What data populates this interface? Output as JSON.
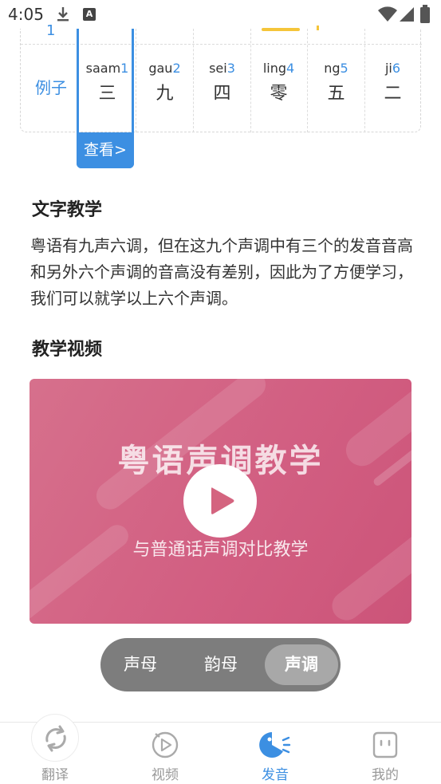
{
  "status_bar": {
    "time": "4:05"
  },
  "tone_table": {
    "top_stub": "1",
    "row_label": "例子",
    "cells": [
      {
        "roman": "saam",
        "tone": "1",
        "hanzi": "三"
      },
      {
        "roman": "gau",
        "tone": "2",
        "hanzi": "九"
      },
      {
        "roman": "sei",
        "tone": "3",
        "hanzi": "四"
      },
      {
        "roman": "ling",
        "tone": "4",
        "hanzi": "零"
      },
      {
        "roman": "ng",
        "tone": "5",
        "hanzi": "五"
      },
      {
        "roman": "ji",
        "tone": "6",
        "hanzi": "二"
      }
    ],
    "view_label": "查看>"
  },
  "text_section": {
    "title": "文字教学",
    "body": "粤语有九声六调，但在这九个声调中有三个的发音音高和另外六个声调的音高没有差别，因此为了方便学习，我们可以就学以上六个声调。"
  },
  "video_section": {
    "title": "教学视频",
    "video_title": "粤语声调教学",
    "video_subtitle": "与普通话声调对比教学"
  },
  "segments": {
    "items": [
      "声母",
      "韵母",
      "声调"
    ],
    "selected": "声调"
  },
  "bottom_nav": {
    "items": [
      {
        "label": "翻译",
        "icon": "sync-icon"
      },
      {
        "label": "视频",
        "icon": "play-circle-icon"
      },
      {
        "label": "发音",
        "icon": "pronunciation-icon"
      },
      {
        "label": "我的",
        "icon": "profile-icon"
      }
    ],
    "active": "发音"
  },
  "colors": {
    "accent": "#3c8fe2",
    "video_bg": "#d25f82",
    "segment_bg": "#7d7d7d",
    "highlight_yellow": "#f5c53a"
  }
}
